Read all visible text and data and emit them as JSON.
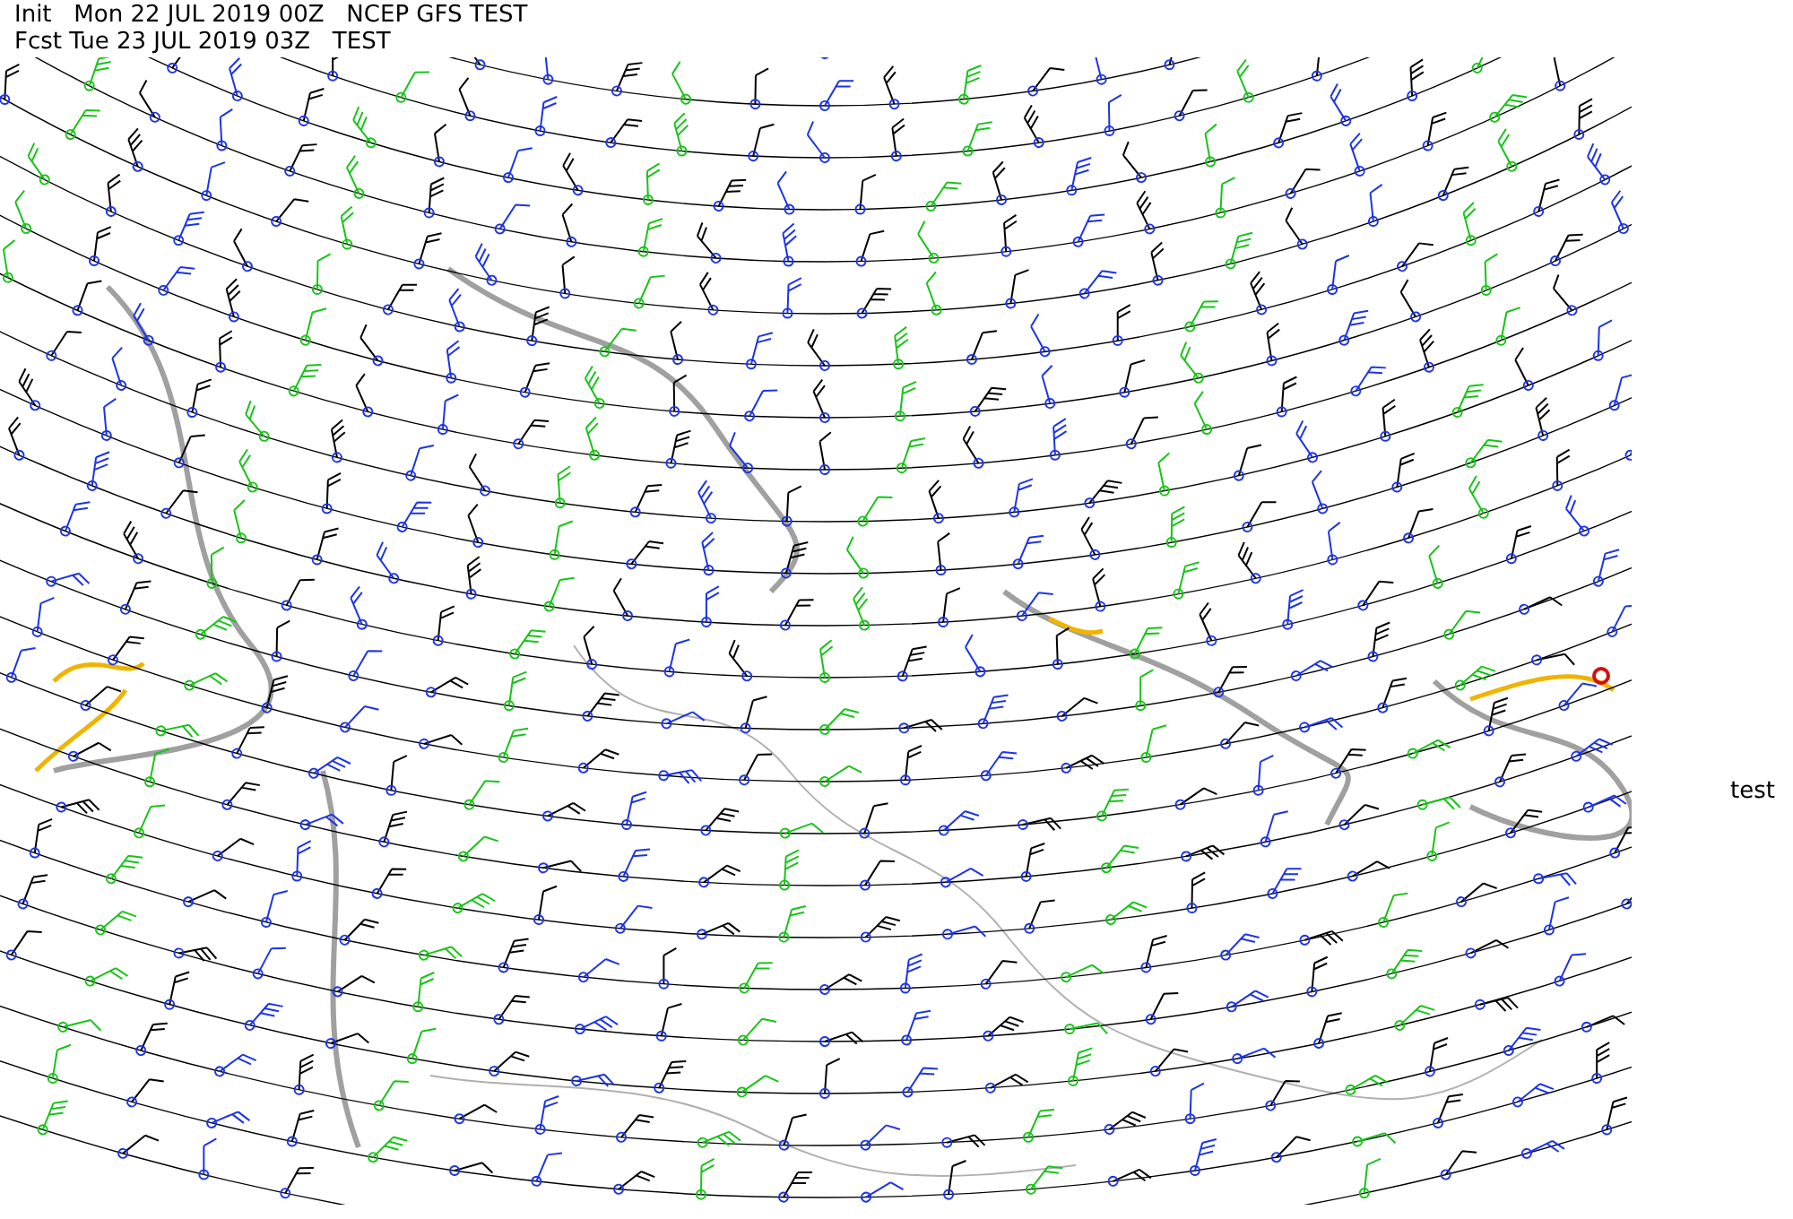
{
  "header": {
    "init_line": "Init   Mon 22 JUL 2019 00Z   NCEP GFS TEST",
    "forecast_line": "Fcst Tue 23 JUL 2019 03Z   TEST"
  },
  "side_label": "test"
}
